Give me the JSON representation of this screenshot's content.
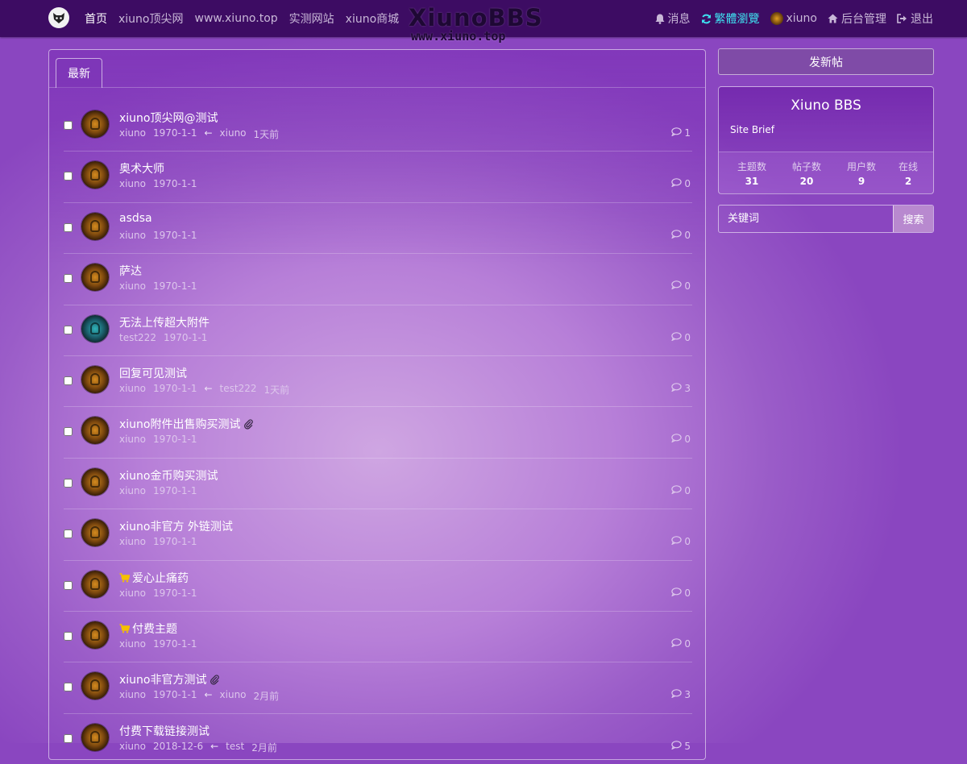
{
  "navbar": {
    "nav_links": [
      "首页",
      "xiuno顶尖网",
      "www.xiuno.top",
      "实测网站",
      "xiuno商城"
    ],
    "brand_title": "XiunoBBS",
    "brand_sub": "www.xiuno.top",
    "messages": "消息",
    "traditional": "繁體瀏覽",
    "username": "xiuno",
    "admin": "后台管理",
    "logout": "退出"
  },
  "tabs": {
    "latest": "最新"
  },
  "threads": [
    {
      "title": "xiuno顶尖网@测试",
      "author": "xiuno",
      "date": "1970-1-1",
      "last_user": "xiuno",
      "last_time": "1天前",
      "replies": "1",
      "icon": "",
      "attach": false,
      "avatar": "gold"
    },
    {
      "title": "奥术大师",
      "author": "xiuno",
      "date": "1970-1-1",
      "last_user": "",
      "last_time": "",
      "replies": "0",
      "icon": "",
      "attach": false,
      "avatar": "gold"
    },
    {
      "title": "asdsa",
      "author": "xiuno",
      "date": "1970-1-1",
      "last_user": "",
      "last_time": "",
      "replies": "0",
      "icon": "",
      "attach": false,
      "avatar": "gold"
    },
    {
      "title": "萨达",
      "author": "xiuno",
      "date": "1970-1-1",
      "last_user": "",
      "last_time": "",
      "replies": "0",
      "icon": "",
      "attach": false,
      "avatar": "gold"
    },
    {
      "title": "无法上传超大附件",
      "author": "test222",
      "date": "1970-1-1",
      "last_user": "",
      "last_time": "",
      "replies": "0",
      "icon": "",
      "attach": false,
      "avatar": "teal"
    },
    {
      "title": "回复可见测试",
      "author": "xiuno",
      "date": "1970-1-1",
      "last_user": "test222",
      "last_time": "1天前",
      "replies": "3",
      "icon": "",
      "attach": false,
      "avatar": "gold"
    },
    {
      "title": "xiuno附件出售购买测试",
      "author": "xiuno",
      "date": "1970-1-1",
      "last_user": "",
      "last_time": "",
      "replies": "0",
      "icon": "",
      "attach": true,
      "avatar": "gold"
    },
    {
      "title": "xiuno金币购买测试",
      "author": "xiuno",
      "date": "1970-1-1",
      "last_user": "",
      "last_time": "",
      "replies": "0",
      "icon": "",
      "attach": false,
      "avatar": "gold"
    },
    {
      "title": "xiuno非官方 外链测试",
      "author": "xiuno",
      "date": "1970-1-1",
      "last_user": "",
      "last_time": "",
      "replies": "0",
      "icon": "",
      "attach": false,
      "avatar": "gold"
    },
    {
      "title": "爱心止痛药",
      "author": "xiuno",
      "date": "1970-1-1",
      "last_user": "",
      "last_time": "",
      "replies": "0",
      "icon": "cart-icon",
      "attach": false,
      "avatar": "gold"
    },
    {
      "title": "付费主题",
      "author": "xiuno",
      "date": "1970-1-1",
      "last_user": "",
      "last_time": "",
      "replies": "0",
      "icon": "cart-icon",
      "attach": false,
      "avatar": "gold"
    },
    {
      "title": "xiuno非官方测试",
      "author": "xiuno",
      "date": "1970-1-1",
      "last_user": "xiuno",
      "last_time": "2月前",
      "replies": "3",
      "icon": "",
      "attach": true,
      "avatar": "gold"
    },
    {
      "title": "付费下载链接测试",
      "author": "xiuno",
      "date": "2018-12-6",
      "last_user": "test",
      "last_time": "2月前",
      "replies": "5",
      "icon": "",
      "attach": false,
      "avatar": "gold"
    }
  ],
  "sidebar": {
    "new_thread": "发新帖",
    "site_title": "Xiuno BBS",
    "site_brief": "Site Brief",
    "stats": [
      {
        "label": "主题数",
        "value": "31"
      },
      {
        "label": "帖子数",
        "value": "20"
      },
      {
        "label": "用户数",
        "value": "9"
      },
      {
        "label": "在线",
        "value": "2"
      }
    ],
    "search_placeholder": "关键词",
    "search_button": "搜索"
  },
  "colors": {
    "navbar": "#3d0c63",
    "highlight": "#3ee0f0",
    "cart": "#f5c000"
  }
}
